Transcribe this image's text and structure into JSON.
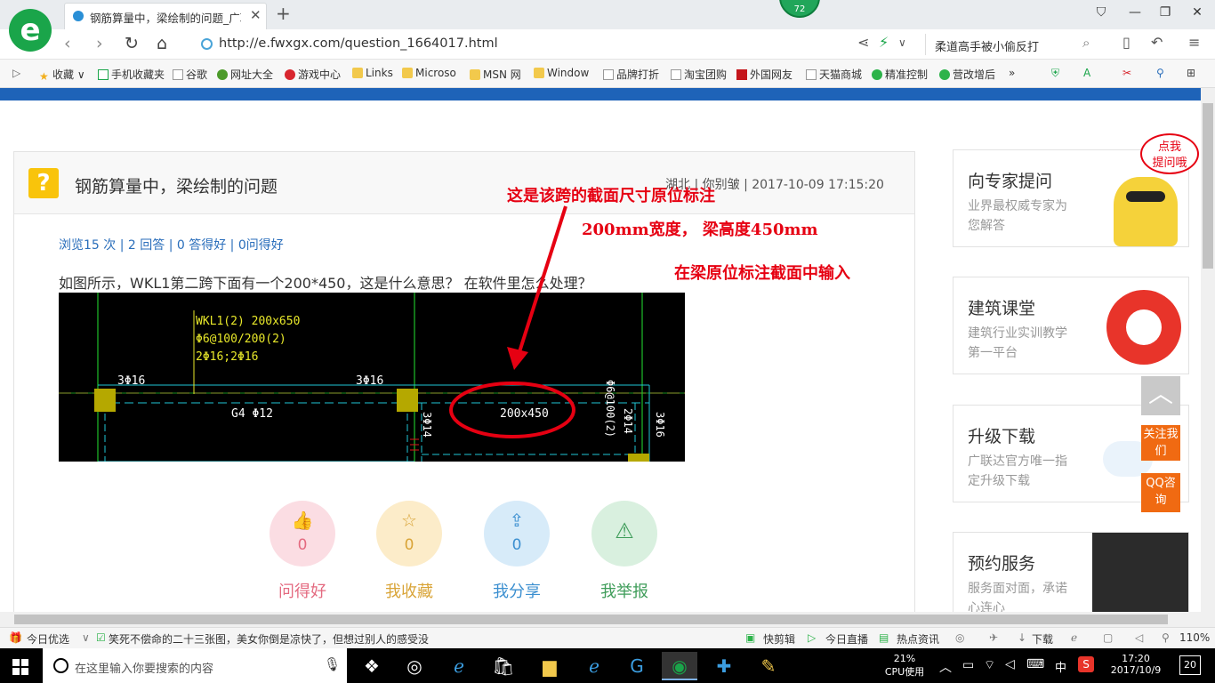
{
  "browser": {
    "badge_count": "72",
    "logo_letter": "e",
    "tab_title": "钢筋算量中，梁绘制的问题_广联",
    "url": "http://e.fwxgx.com/question_1664017.html",
    "search_text": "柔道高手被小偷反打"
  },
  "bookmarks": [
    {
      "label": "收藏",
      "icon": "star-icon"
    },
    {
      "label": "手机收藏夹",
      "icon": "phone-icon"
    },
    {
      "label": "谷歌",
      "icon": "page-icon"
    },
    {
      "label": "网址大全",
      "icon": "globe-icon"
    },
    {
      "label": "游戏中心",
      "icon": "game-icon"
    },
    {
      "label": "Links",
      "icon": "folder-icon"
    },
    {
      "label": "Microso",
      "icon": "folder-icon"
    },
    {
      "label": "MSN 网",
      "icon": "folder-icon"
    },
    {
      "label": "Window",
      "icon": "folder-icon"
    },
    {
      "label": "品牌打折",
      "icon": "page-icon"
    },
    {
      "label": "淘宝团购",
      "icon": "page-icon"
    },
    {
      "label": "外国网友",
      "icon": "page-icon"
    },
    {
      "label": "天猫商城",
      "icon": "page-icon"
    },
    {
      "label": "精准控制",
      "icon": "chat-icon"
    },
    {
      "label": "营改增后",
      "icon": "chat-icon"
    }
  ],
  "question": {
    "title": "钢筋算量中，梁绘制的问题",
    "meta": "湖北 | 你别皱 | 2017-10-09 17:15:20",
    "stats": "浏览15 次 | 2 回答 | 0 答得好 | 0问得好",
    "body": "如图所示，WKL1第二跨下面有一个200*450，这是什么意思？   在软件里怎么处理？"
  },
  "cad": {
    "beam_label_1": "WKL1(2) 200x650",
    "beam_label_2": "Φ6@100/200(2)",
    "beam_label_3": "2Φ16;2Φ16",
    "rebar_left": "3Φ16",
    "rebar_mid": "3Φ16",
    "g4": "G4 Φ12",
    "section": "200x450",
    "v1": "3Φ14",
    "v2": "Φ6@100(2)",
    "v3": "2Φ14",
    "v4": "3Φ16"
  },
  "annotations": {
    "line1": "这是该跨的截面尺寸原位标注",
    "line2": "200mm宽度，  梁高度450mm",
    "line3": "在梁原位标注截面中输入"
  },
  "actions": [
    {
      "label": "问得好",
      "count": "0",
      "icon": "thumbs-up-icon",
      "color": "#e46a80",
      "bg": "#fbdde3"
    },
    {
      "label": "我收藏",
      "count": "0",
      "icon": "star-icon",
      "color": "#d9a437",
      "bg": "#fcecc9"
    },
    {
      "label": "我分享",
      "count": "0",
      "icon": "share-icon",
      "color": "#3b8fd0",
      "bg": "#d7ebf9"
    },
    {
      "label": "我举报",
      "count": "",
      "icon": "warning-icon",
      "color": "#3f9d5a",
      "bg": "#d9f0df"
    }
  ],
  "sidebar": [
    {
      "title": "向专家提问",
      "sub": "业界最权威专家为您解答"
    },
    {
      "title": "建筑课堂",
      "sub": "建筑行业实训教学第一平台"
    },
    {
      "title": "升级下载",
      "sub": "广联达官方唯一指定升级下载"
    },
    {
      "title": "预约服务",
      "sub": "服务面对面，承诺心连心"
    }
  ],
  "bubble": {
    "line1": "点我",
    "line2": "提问哦"
  },
  "float_buttons": {
    "follow": "关注我们",
    "qq": "QQ咨询"
  },
  "statusbar": {
    "today": "今日优选",
    "news": "笑死不偿命的二十三张图，美女你倒是凉快了，但想过别人的感受没",
    "clip": "快剪辑",
    "live": "今日直播",
    "hot": "热点资讯",
    "download": "下载",
    "zoom": "110%"
  },
  "taskbar": {
    "search_placeholder": "在这里输入你要搜索的内容",
    "cpu_percent": "21%",
    "cpu_label": "CPU使用",
    "ime": "中",
    "time": "17:20",
    "date": "2017/10/9",
    "notifications": "20"
  },
  "colors": {
    "accent_blue": "#1e63b8",
    "annotation_red": "#e60012",
    "float_orange": "#f06a12"
  }
}
